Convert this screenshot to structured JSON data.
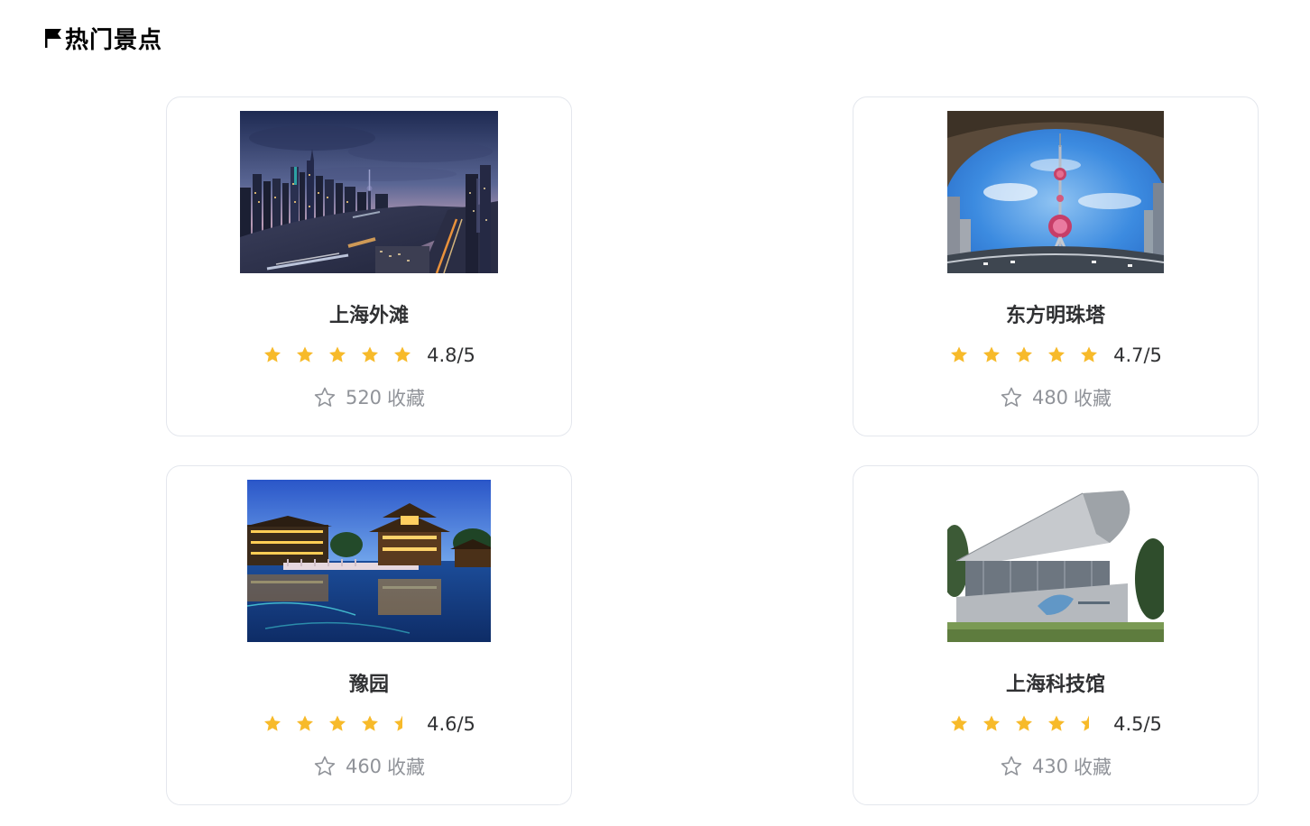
{
  "section": {
    "title": "热门景点",
    "icon": "flag-icon"
  },
  "colors": {
    "star": "#F7BA2A",
    "star_empty": "#E4E7ED",
    "border": "#E4E7ED",
    "muted": "#909399",
    "text": "#303133"
  },
  "attractions": [
    {
      "name": "上海外滩",
      "rating": 4.8,
      "rating_text": "4.8/5",
      "stars": 5,
      "favorites_count": "520",
      "favorites_label": "收藏",
      "image": "bund-night-skyline"
    },
    {
      "name": "东方明珠塔",
      "rating": 4.7,
      "rating_text": "4.7/5",
      "stars": 5,
      "favorites_count": "480",
      "favorites_label": "收藏",
      "image": "oriental-pearl-tower"
    },
    {
      "name": "豫园",
      "rating": 4.6,
      "rating_text": "4.6/5",
      "stars": 4.5,
      "favorites_count": "460",
      "favorites_label": "收藏",
      "image": "yu-garden-night"
    },
    {
      "name": "上海科技馆",
      "rating": 4.5,
      "rating_text": "4.5/5",
      "stars": 4.5,
      "favorites_count": "430",
      "favorites_label": "收藏",
      "image": "science-museum"
    }
  ]
}
